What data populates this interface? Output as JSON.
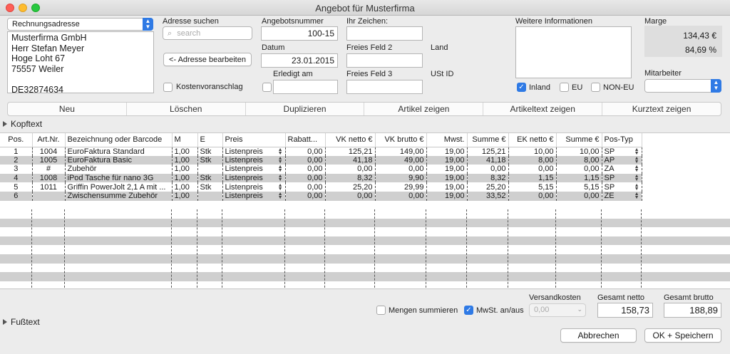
{
  "window": {
    "title": "Angebot für Musterfirma"
  },
  "address": {
    "type_select": "Rechnungsadresse",
    "lines": [
      "Musterfirma GmbH",
      "Herr Stefan Meyer",
      "Hoge Loht 67",
      "75557 Weiler",
      "",
      "DE32874634"
    ],
    "search_label": "Adresse suchen",
    "search_placeholder": "search",
    "edit_button": "<- Adresse bearbeiten",
    "estimate_label": "Kostenvoranschlag",
    "estimate_checked": false
  },
  "offer": {
    "number_label": "Angebotsnummer",
    "number": "100-15",
    "date_label": "Datum",
    "date": "23.01.2015",
    "done_label": "Erledigt am",
    "done_value": "",
    "done_checked": false,
    "reference_label": "Ihr Zeichen:",
    "reference": "",
    "free2_label": "Freies Feld 2",
    "free2": "",
    "free3_label": "Freies Feld 3",
    "free3": "",
    "country_label": "Land",
    "vat_id_label": "USt ID"
  },
  "info": {
    "label": "Weitere Informationen",
    "text": "",
    "inland_label": "Inland",
    "inland_checked": true,
    "eu_label": "EU",
    "eu_checked": false,
    "noneu_label": "NON-EU",
    "noneu_checked": false
  },
  "margin": {
    "label": "Marge",
    "amount": "134,43 €",
    "percent": "84,69 %"
  },
  "employee": {
    "label": "Mitarbeiter",
    "value": ""
  },
  "toolbar": [
    "Neu",
    "Löschen",
    "Duplizieren",
    "Artikel zeigen",
    "Artikeltext zeigen",
    "Kurztext zeigen"
  ],
  "header_text_label": "Kopftext",
  "footer_text_label": "Fußtext",
  "table": {
    "columns": [
      "Pos.",
      "Art.Nr.",
      "Bezeichnung oder Barcode",
      "M",
      "E",
      "Preis",
      "Rabatt...",
      "VK netto €",
      "VK brutto €",
      "Mwst.",
      "Summe €",
      "EK netto €",
      "Summe €",
      "Pos-Typ"
    ],
    "rows": [
      [
        "1",
        "1004",
        "EuroFaktura Standard",
        "1,00",
        "Stk",
        "Listenpreis",
        "0,00",
        "125,21",
        "149,00",
        "19,00",
        "125,21",
        "10,00",
        "10,00",
        "SP"
      ],
      [
        "2",
        "1005",
        "EuroFaktura Basic",
        "1,00",
        "Stk",
        "Listenpreis",
        "0,00",
        "41,18",
        "49,00",
        "19,00",
        "41,18",
        "8,00",
        "8,00",
        "AP"
      ],
      [
        "3",
        "#",
        "Zubehör",
        "1,00",
        "",
        "Listenpreis",
        "0,00",
        "0,00",
        "0,00",
        "19,00",
        "0,00",
        "0,00",
        "0,00",
        "ZA"
      ],
      [
        "4",
        "1008",
        "iPod Tasche für nano 3G",
        "1,00",
        "Stk",
        "Listenpreis",
        "0,00",
        "8,32",
        "9,90",
        "19,00",
        "8,32",
        "1,15",
        "1,15",
        "SP"
      ],
      [
        "5",
        "1011",
        "Griffin PowerJolt 2,1 A mit ...",
        "1,00",
        "Stk",
        "Listenpreis",
        "0,00",
        "25,20",
        "29,99",
        "19,00",
        "25,20",
        "5,15",
        "5,15",
        "SP"
      ],
      [
        "6",
        "",
        "Zwischensumme Zubehör",
        "1,00",
        "",
        "Listenpreis",
        "0,00",
        "0,00",
        "0,00",
        "19,00",
        "33,52",
        "0,00",
        "0,00",
        "ZE"
      ]
    ]
  },
  "totals": {
    "sum_quantities_label": "Mengen summieren",
    "sum_quantities_checked": false,
    "vat_label": "MwSt. an/aus",
    "vat_checked": true,
    "shipping_label": "Versandkosten",
    "shipping": "0,00",
    "net_label": "Gesamt netto",
    "net": "158,73",
    "gross_label": "Gesamt brutto",
    "gross": "188,89"
  },
  "buttons": {
    "cancel": "Abbrechen",
    "save": "OK + Speichern"
  },
  "colors": {
    "accent": "#2f7ae5",
    "row_stripe": "#cfcfcf"
  }
}
